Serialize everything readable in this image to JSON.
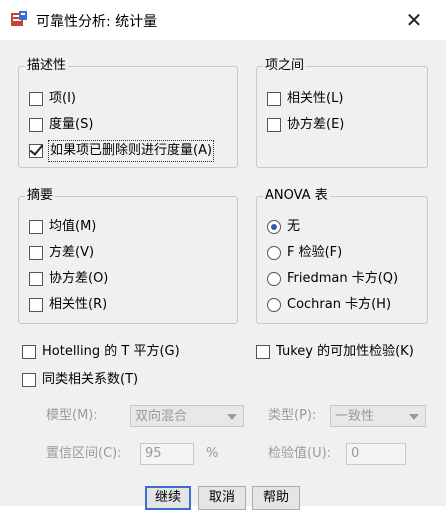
{
  "window": {
    "title": "可靠性分析: 统计量",
    "close_symbol": "✕"
  },
  "descriptives": {
    "title": "描述性",
    "items": [
      {
        "label": "项(I)",
        "checked": false
      },
      {
        "label": "度量(S)",
        "checked": false
      },
      {
        "label": "如果项已删除则进行度量(A)",
        "checked": true
      }
    ]
  },
  "inter_item": {
    "title": "项之间",
    "items": [
      {
        "label": "相关性(L)",
        "checked": false
      },
      {
        "label": "协方差(E)",
        "checked": false
      }
    ]
  },
  "summaries": {
    "title": "摘要",
    "items": [
      {
        "label": "均值(M)",
        "checked": false
      },
      {
        "label": "方差(V)",
        "checked": false
      },
      {
        "label": "协方差(O)",
        "checked": false
      },
      {
        "label": "相关性(R)",
        "checked": false
      }
    ]
  },
  "anova": {
    "title": "ANOVA 表",
    "options": [
      {
        "label": "无",
        "selected": true
      },
      {
        "label": "F 检验(F)",
        "selected": false
      },
      {
        "label": "Friedman 卡方(Q)",
        "selected": false
      },
      {
        "label": "Cochran 卡方(H)",
        "selected": false
      }
    ]
  },
  "options": {
    "hotelling": "Hotelling 的 T 平方(G)",
    "tukey": "Tukey 的可加性检验(K)",
    "icc": "同类相关系数(T)"
  },
  "icc_settings": {
    "model_label": "模型(M):",
    "model_value": "双向混合",
    "type_label": "类型(P):",
    "type_value": "一致性",
    "ci_label": "置信区间(C):",
    "ci_value": "95",
    "ci_unit": "%",
    "test_label": "检验值(U):",
    "test_value": "0"
  },
  "buttons": {
    "continue": "继续",
    "cancel": "取消",
    "help": "帮助"
  }
}
